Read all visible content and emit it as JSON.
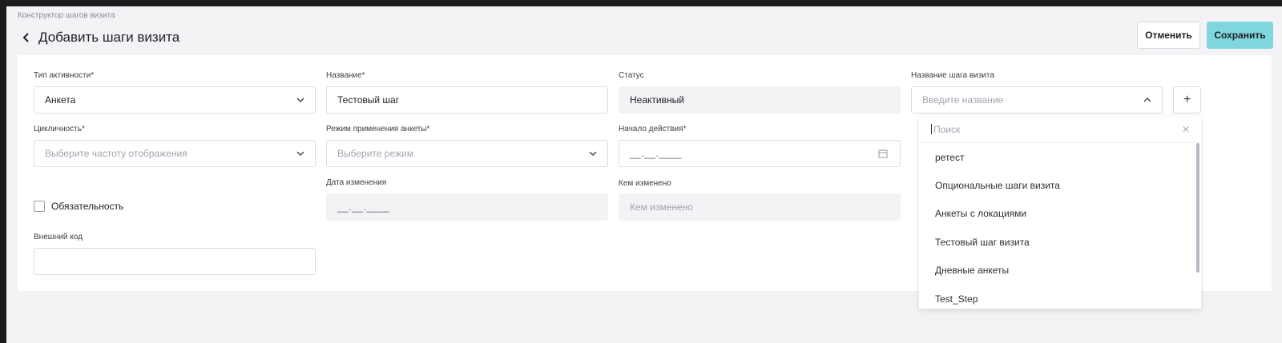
{
  "breadcrumb": "Конструктор шагов визита",
  "header": {
    "title": "Добавить шаги визита"
  },
  "actions": {
    "cancel_label": "Отменить",
    "save_label": "Сохранить"
  },
  "form": {
    "activity_type": {
      "label": "Тип активности*",
      "value": "Анкета"
    },
    "name": {
      "label": "Название*",
      "value": "Тестовый шаг"
    },
    "status": {
      "label": "Статус",
      "value": "Неактивный"
    },
    "step_name": {
      "label": "Название шага визита",
      "placeholder": "Введите название"
    },
    "cyclicity": {
      "label": "Цикличность*",
      "placeholder": "Выберите частоту отображения"
    },
    "mode": {
      "label": "Режим применения анкеты*",
      "placeholder": "Выберите режим"
    },
    "start": {
      "label": "Начало действия*",
      "mask": "__.__.____"
    },
    "modified_date": {
      "label": "Дата изменения",
      "mask": "__.__.____"
    },
    "modified_by": {
      "label": "Кем изменено",
      "placeholder": "Кем изменено"
    },
    "mandatory": {
      "label": "Обязательность",
      "checked": false
    },
    "external_code": {
      "label": "Внешний код",
      "value": ""
    },
    "add_icon": "+"
  },
  "dropdown": {
    "search_placeholder": "Поиск",
    "clear_icon": "✕",
    "items": [
      "ретест",
      "Опциональные шаги визита",
      "Анкеты с локациями",
      "Тестовый шаг визита",
      "Дневные анкеты",
      "Test_Step"
    ]
  },
  "colors": {
    "accent": "#7fd6dc",
    "background": "#f3f3f6"
  }
}
